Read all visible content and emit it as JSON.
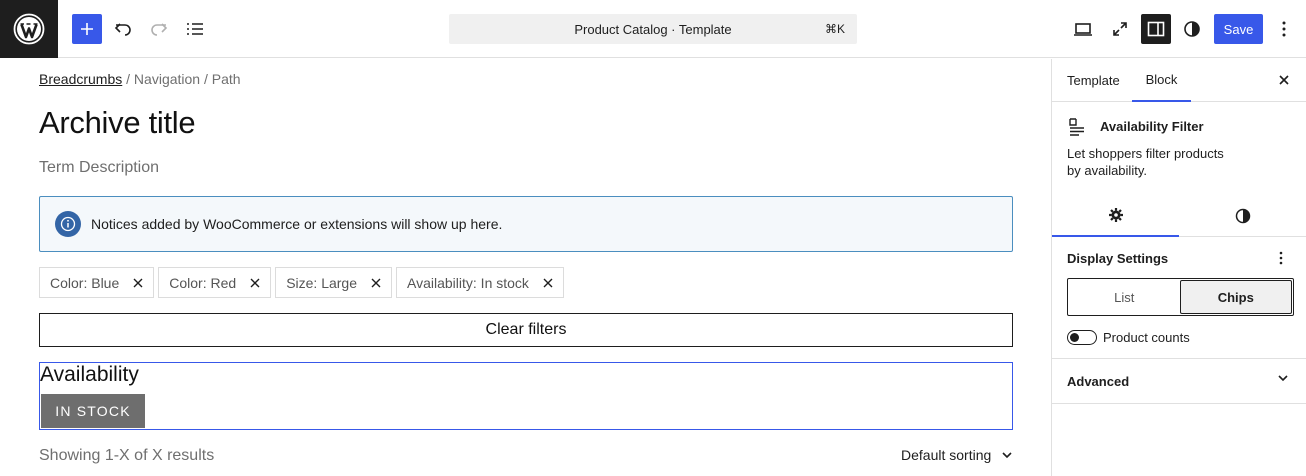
{
  "topbar": {
    "command_title": "Product Catalog · Template",
    "command_shortcut": "⌘K",
    "save_label": "Save",
    "icons": [
      "wordpress-logo",
      "plus-icon",
      "undo-icon",
      "redo-icon",
      "list-view-icon",
      "desktop-icon",
      "fullscreen-icon",
      "sidebar-icon",
      "styles-icon",
      "more-vertical-icon"
    ],
    "accent_color": "#3858e9"
  },
  "canvas": {
    "breadcrumbs": {
      "link": "Breadcrumbs",
      "rest": " / Navigation / Path"
    },
    "archive_title": "Archive title",
    "term_description": "Term Description",
    "notice": "Notices added by WooCommerce or extensions will show up here.",
    "active_filters": [
      {
        "label": "Color: Blue"
      },
      {
        "label": "Color: Red"
      },
      {
        "label": "Size: Large"
      },
      {
        "label": "Availability: In stock"
      }
    ],
    "clear_filters": "Clear filters",
    "availability": {
      "heading": "Availability",
      "chip": "IN STOCK"
    },
    "results_text": "Showing 1-X of X results",
    "sorting": "Default sorting"
  },
  "sidebar": {
    "tabs": {
      "template": "Template",
      "block": "Block",
      "active": "Block"
    },
    "block": {
      "name": "Availability Filter",
      "description": "Let shoppers filter products by availability."
    },
    "display_settings": {
      "title": "Display Settings",
      "options": {
        "list": "List",
        "chips": "Chips"
      },
      "selected": "Chips",
      "product_counts_label": "Product counts",
      "product_counts_enabled": false
    },
    "advanced_label": "Advanced"
  }
}
